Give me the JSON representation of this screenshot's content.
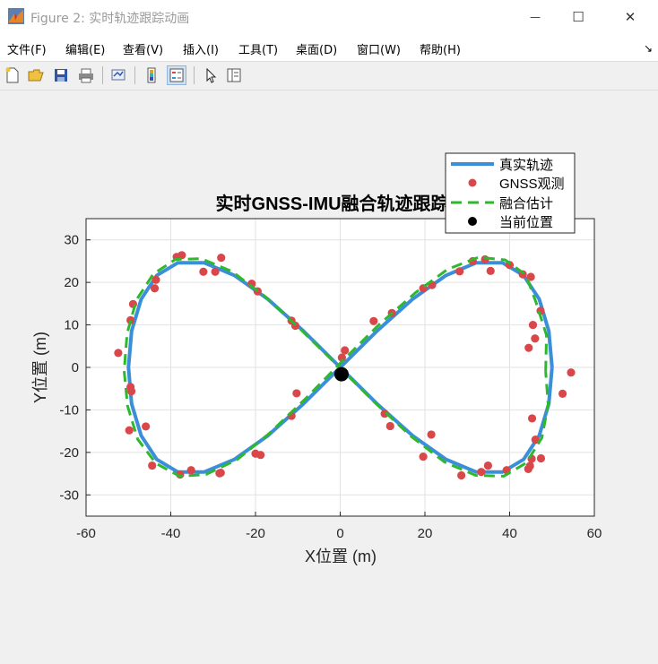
{
  "window": {
    "title": "Figure 2: 实时轨迹跟踪动画",
    "minimize_glyph": "—",
    "maximize_glyph": "☐",
    "close_glyph": "✕"
  },
  "menu": {
    "items": [
      "文件(F)",
      "编辑(E)",
      "查看(V)",
      "插入(I)",
      "工具(T)",
      "桌面(D)",
      "窗口(W)",
      "帮助(H)"
    ],
    "extra_glyph": "↘"
  },
  "toolbar": {
    "icons": [
      "new-figure-icon",
      "open-file-icon",
      "save-icon",
      "print-icon",
      "link-plot-icon",
      "insert-colorbar-icon",
      "insert-legend-icon",
      "pointer-arrow-icon",
      "property-inspector-icon"
    ],
    "active_icon": "insert-legend-icon"
  },
  "colors": {
    "true_line": "#3b8fd9",
    "gnss": "#d9474a",
    "fused": "#2db82d",
    "current": "#000000"
  },
  "chart_data": {
    "type": "line",
    "title": "实时GNSS-IMU融合轨迹跟踪 (t",
    "xlabel": "X位置 (m)",
    "ylabel": "Y位置 (m)",
    "xlim": [
      -60,
      60
    ],
    "ylim": [
      -35,
      35
    ],
    "xticks": [
      "-60",
      "-40",
      "-20",
      "0",
      "20",
      "40",
      "60"
    ],
    "yticks": [
      "-30",
      "-20",
      "-10",
      "0",
      "10",
      "20",
      "30"
    ],
    "grid": true,
    "legend_position": "top-right, overlapping title",
    "legend": [
      "真实轨迹",
      "GNSS观测",
      "融合估计",
      "当前位置"
    ],
    "true_trajectory": {
      "x": [
        50,
        49.24,
        46.98,
        43.3,
        38.3,
        32.14,
        25,
        17.1,
        8.68,
        0,
        -8.68,
        -17.1,
        -25,
        -32.14,
        -38.3,
        -43.3,
        -46.98,
        -49.24,
        -50,
        -49.24,
        -46.98,
        -43.3,
        -38.3,
        -32.14,
        -25,
        -17.1,
        -8.68,
        0,
        8.68,
        17.1,
        25,
        32.14,
        38.3,
        43.3,
        46.98,
        49.24,
        50
      ],
      "y": [
        0,
        8.55,
        16.07,
        21.65,
        24.62,
        24.62,
        21.65,
        16.07,
        8.55,
        0,
        -8.55,
        -16.07,
        -21.65,
        -24.62,
        -24.62,
        -21.65,
        -16.07,
        -8.55,
        0,
        8.55,
        16.07,
        21.65,
        24.62,
        24.62,
        21.65,
        16.07,
        8.55,
        0,
        -8.55,
        -16.07,
        -21.65,
        -24.62,
        -24.62,
        -21.65,
        -16.07,
        -8.55,
        0
      ]
    },
    "fused_estimate": {
      "x": [
        48.5,
        48.7,
        46.2,
        43.8,
        38.9,
        32.6,
        25.4,
        17.8,
        9.2,
        0.5,
        -8.1,
        -16.6,
        -24.3,
        -31.7,
        -37.9,
        -43.5,
        -47.8,
        -50.2,
        -51,
        -50.3,
        -48.1,
        -44.1,
        -38.9,
        -32.8,
        -25.6,
        -17.6,
        -9.2,
        -0.6,
        8.1,
        16.7,
        24.7,
        32,
        38.6,
        43.9,
        47.6,
        49.1,
        48.5
      ],
      "y": [
        -1,
        7.6,
        15.4,
        21.8,
        25.3,
        25.9,
        23.1,
        17.6,
        10.1,
        1.5,
        -7.3,
        -15.4,
        -21.7,
        -25.2,
        -25.6,
        -22.6,
        -16.9,
        -9.1,
        -0.8,
        8,
        15.9,
        22,
        25.4,
        25.6,
        22.6,
        16.6,
        8.8,
        0.4,
        -8.2,
        -16.2,
        -22.3,
        -25.4,
        -25.6,
        -22.5,
        -16.6,
        -8.8,
        -1
      ]
    },
    "gnss_observations": {
      "x": [
        54.5,
        46,
        47.3,
        45,
        45.5,
        44.5,
        43.1,
        40,
        35.5,
        34.2,
        31.3,
        28.2,
        21.7,
        19.6,
        12.2,
        7.9,
        1.1,
        0.4,
        -10.6,
        -11.5,
        -19.5,
        -20.9,
        -28.1,
        -29.5,
        -32.3,
        -37.4,
        -38.6,
        -43.5,
        -43.8,
        -49.5,
        -48.9,
        -52.4,
        -49.5,
        -49.3,
        -49.8,
        -45.9,
        -44.4,
        -37.8,
        -35.2,
        -28.5,
        -28.2,
        -20,
        -18.8,
        -11.5,
        -10.3,
        10.5,
        11.8,
        19.6,
        21.5,
        28.6,
        33.3,
        34.9,
        39.3,
        45.3,
        46.1,
        47.4,
        45.2,
        44.8,
        52.5,
        44.4
      ],
      "y": [
        -1.2,
        6.8,
        13.3,
        21.3,
        10,
        4.6,
        21.9,
        24.1,
        22.7,
        25.4,
        25,
        22.6,
        19.4,
        18.6,
        12.8,
        10.9,
        4,
        2.3,
        9.8,
        11,
        17.9,
        19.7,
        25.8,
        22.5,
        22.5,
        26.4,
        26,
        20.6,
        18.6,
        11.1,
        14.9,
        3.4,
        -4.6,
        -5.6,
        -14.8,
        -13.9,
        -23.1,
        -25.2,
        -24.2,
        -24.9,
        -24.8,
        -20.3,
        -20.6,
        -11.4,
        -6.1,
        -10.9,
        -13.8,
        -21,
        -15.8,
        -25.4,
        -24.6,
        -23.1,
        -24.2,
        -12,
        -17,
        -21.4,
        -21.5,
        -23.2,
        -6.2,
        -23.9
      ]
    },
    "current_position": {
      "x": 0.3,
      "y": -1.6
    }
  }
}
